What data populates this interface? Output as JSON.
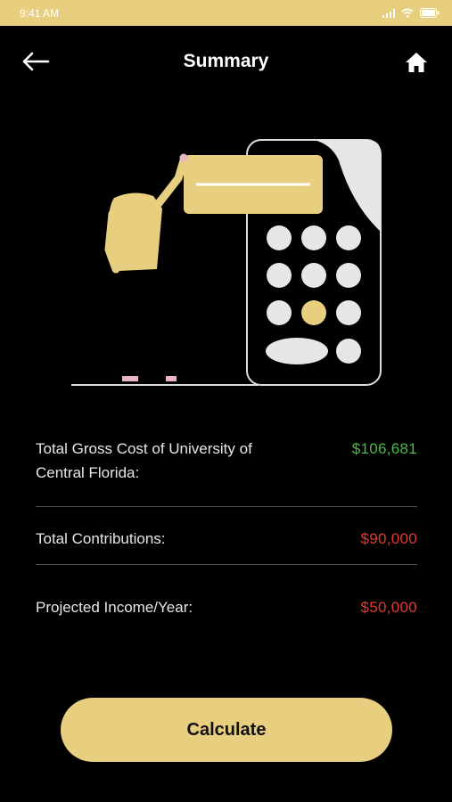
{
  "status_bar": {
    "time": "9:41 AM",
    "icons": [
      "cellular-signal-icon",
      "wifi-icon",
      "battery-icon"
    ]
  },
  "header": {
    "title": "Summary",
    "back_icon": "arrow-left-icon",
    "home_icon": "home-icon"
  },
  "illustration": {
    "subject": "person-at-calculator-illustration"
  },
  "summary": {
    "rows": [
      {
        "label": "Total Gross Cost of University of Central Florida:",
        "value": "$106,681"
      },
      {
        "label": "Total Contributions:",
        "value": "$90,000"
      },
      {
        "label": "Projected Income/Year:",
        "value": "$50,000"
      }
    ]
  },
  "actions": {
    "calculate_label": "Calculate"
  },
  "colors": {
    "accent": "#e8cf7f",
    "background": "#000000",
    "positive": "#4fb848",
    "negative": "#e03a35"
  }
}
